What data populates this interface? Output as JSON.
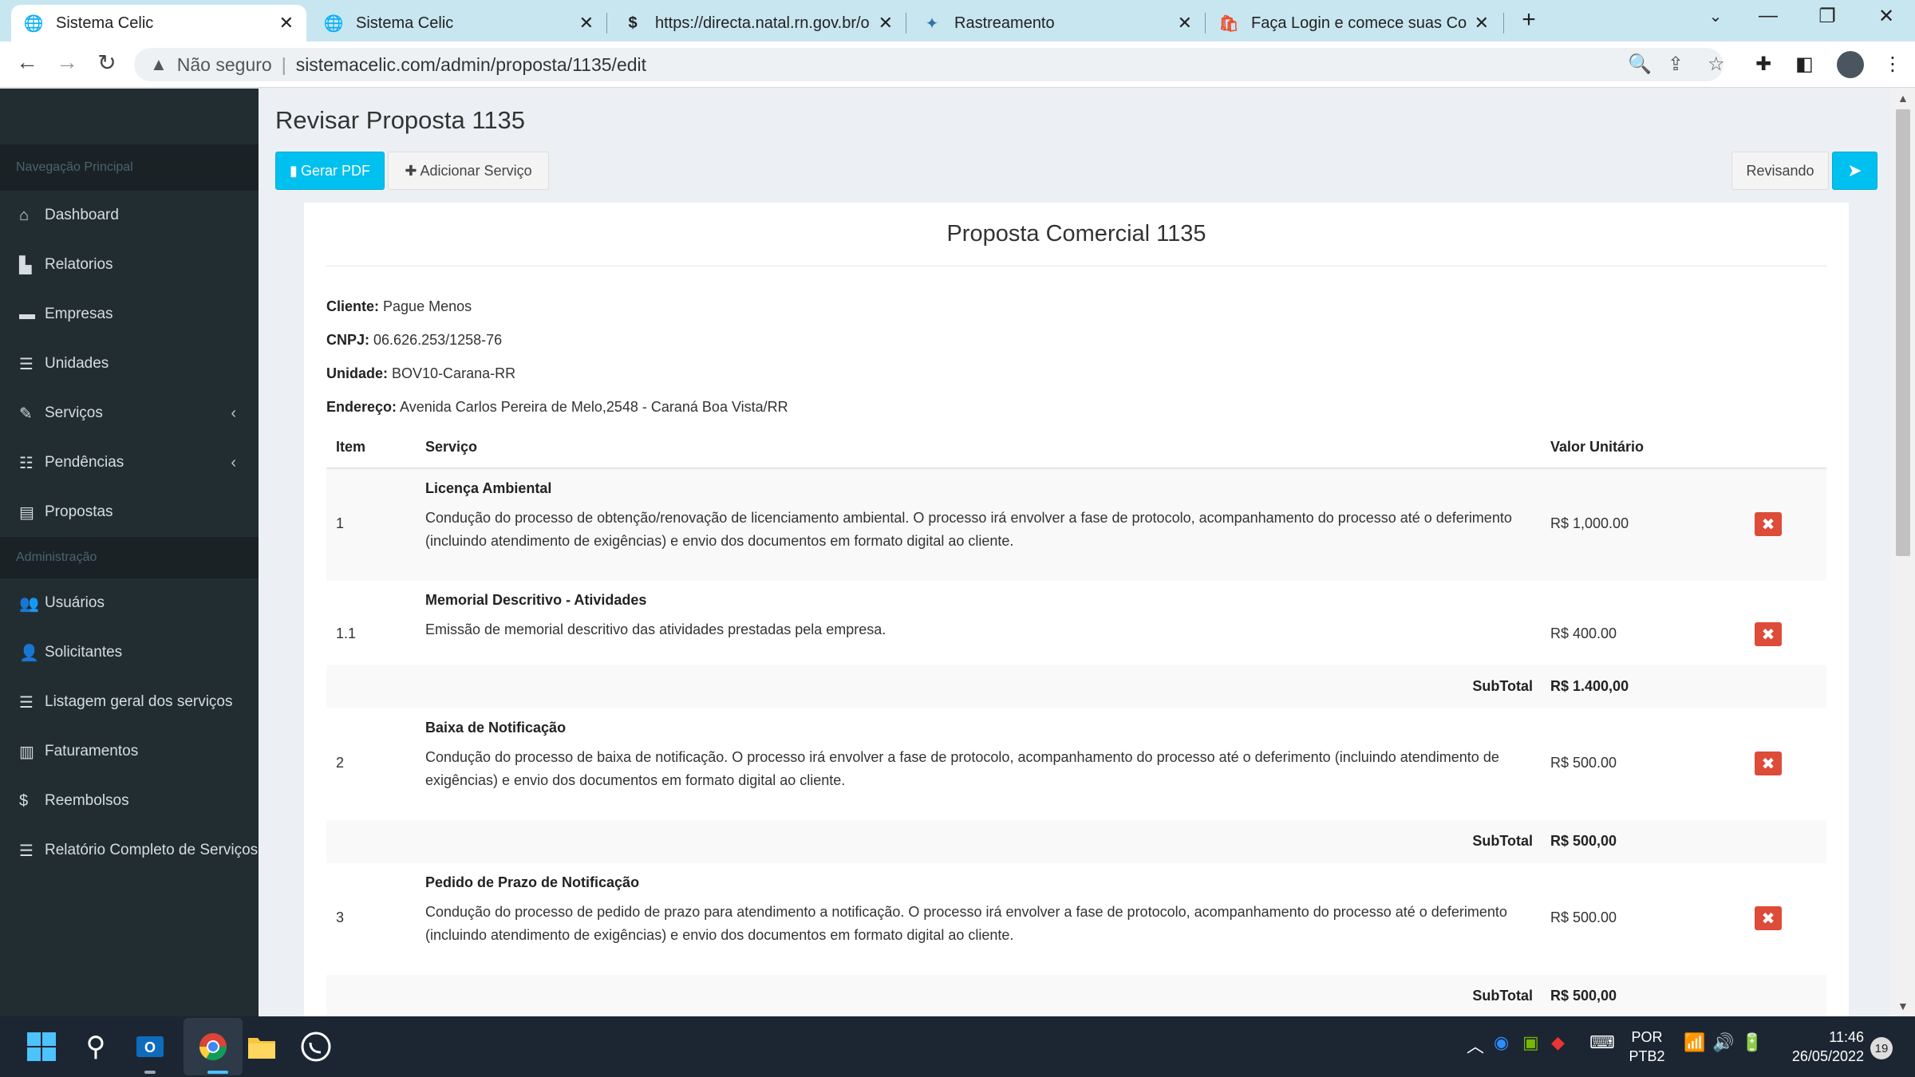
{
  "browser": {
    "tabs": [
      {
        "title": "Sistema Celic",
        "icon": "globe-icon",
        "active": true
      },
      {
        "title": "Sistema Celic",
        "icon": "globe-icon",
        "active": false
      },
      {
        "title": "https://directa.natal.rn.gov.br/op",
        "icon": "dollar-icon",
        "active": false
      },
      {
        "title": "Rastreamento",
        "icon": "python-icon",
        "active": false
      },
      {
        "title": "Faça Login e comece suas Compr",
        "icon": "shopee-icon",
        "active": false
      }
    ],
    "not_secure_label": "Não seguro",
    "url": "sistemacelic.com/admin/proposta/1135/edit"
  },
  "sidebar": {
    "section_main": "Navegação Principal",
    "main_items": [
      {
        "label": "Dashboard",
        "icon": "home-icon",
        "glyph": "⌂"
      },
      {
        "label": "Relatorios",
        "icon": "bar-chart-icon",
        "glyph": "▙"
      },
      {
        "label": "Empresas",
        "icon": "briefcase-icon",
        "glyph": "▬"
      },
      {
        "label": "Unidades",
        "icon": "list-icon",
        "glyph": "☰"
      },
      {
        "label": "Serviços",
        "icon": "wrench-icon",
        "glyph": "✎",
        "chevron": true
      },
      {
        "label": "Pendências",
        "icon": "tasks-icon",
        "glyph": "☷",
        "chevron": true
      },
      {
        "label": "Propostas",
        "icon": "card-icon",
        "glyph": "▤"
      }
    ],
    "section_admin": "Administração",
    "admin_items": [
      {
        "label": "Usuários",
        "icon": "users-icon",
        "glyph": "👥"
      },
      {
        "label": "Solicitantes",
        "icon": "user-icon",
        "glyph": "👤"
      },
      {
        "label": "Listagem geral dos serviços",
        "icon": "table-list-icon",
        "glyph": "☰"
      },
      {
        "label": "Faturamentos",
        "icon": "barcode-icon",
        "glyph": "▥"
      },
      {
        "label": "Reembolsos",
        "icon": "dollar-icon",
        "glyph": "$"
      },
      {
        "label": "Relatório Completo de Serviços",
        "icon": "table-list-icon",
        "glyph": "☰"
      }
    ]
  },
  "page": {
    "title": "Revisar Proposta 1135",
    "btn_pdf": "Gerar PDF",
    "btn_add": "Adicionar Serviço",
    "btn_status": "Revisando"
  },
  "proposal": {
    "title": "Proposta Comercial 1135",
    "cliente_label": "Cliente:",
    "cliente": "Pague Menos",
    "cnpj_label": "CNPJ:",
    "cnpj": "06.626.253/1258-76",
    "unidade_label": "Unidade:",
    "unidade": "BOV10-Carana-RR",
    "endereco_label": "Endereço:",
    "endereco": "Avenida Carlos Pereira de Melo,2548 - Caraná Boa Vista/RR",
    "columns": {
      "item": "Item",
      "servico": "Serviço",
      "valor": "Valor Unitário"
    },
    "subtotal_label": "SubTotal",
    "rows": [
      {
        "item": "1",
        "name": "Licença Ambiental",
        "desc": "Condução do processo de obtenção/renovação de licenciamento ambiental. O processo irá envolver a fase de protocolo, acompanhamento do processo até o deferimento (incluindo atendimento de exigências) e envio dos documentos em formato digital ao cliente.",
        "value": "R$ 1,000.00"
      },
      {
        "item": "1.1",
        "name": "Memorial Descritivo - Atividades",
        "desc": "Emissão de memorial descritivo das atividades prestadas pela empresa.",
        "value": "R$ 400.00"
      },
      {
        "subtotal": "R$ 1.400,00"
      },
      {
        "item": "2",
        "name": "Baixa de Notificação",
        "desc": "Condução do processo de baixa de notificação. O processo irá envolver a fase de protocolo, acompanhamento do processo até o deferimento (incluindo atendimento de exigências) e envio dos documentos em formato digital ao cliente.",
        "value": "R$ 500.00"
      },
      {
        "subtotal": "R$ 500,00"
      },
      {
        "item": "3",
        "name": "Pedido de Prazo de Notificação",
        "desc": "Condução do processo de pedido de prazo para atendimento a notificação. O processo irá envolver a fase de protocolo, acompanhamento do processo até o deferimento (incluindo atendimento de exigências) e envio dos documentos em formato digital ao cliente.",
        "value": "R$ 500.00"
      },
      {
        "subtotal": "R$ 500,00"
      }
    ]
  },
  "taskbar": {
    "lang_top": "POR",
    "lang_bottom": "PTB2",
    "time": "11:46",
    "date": "26/05/2022",
    "notifications": "19"
  }
}
